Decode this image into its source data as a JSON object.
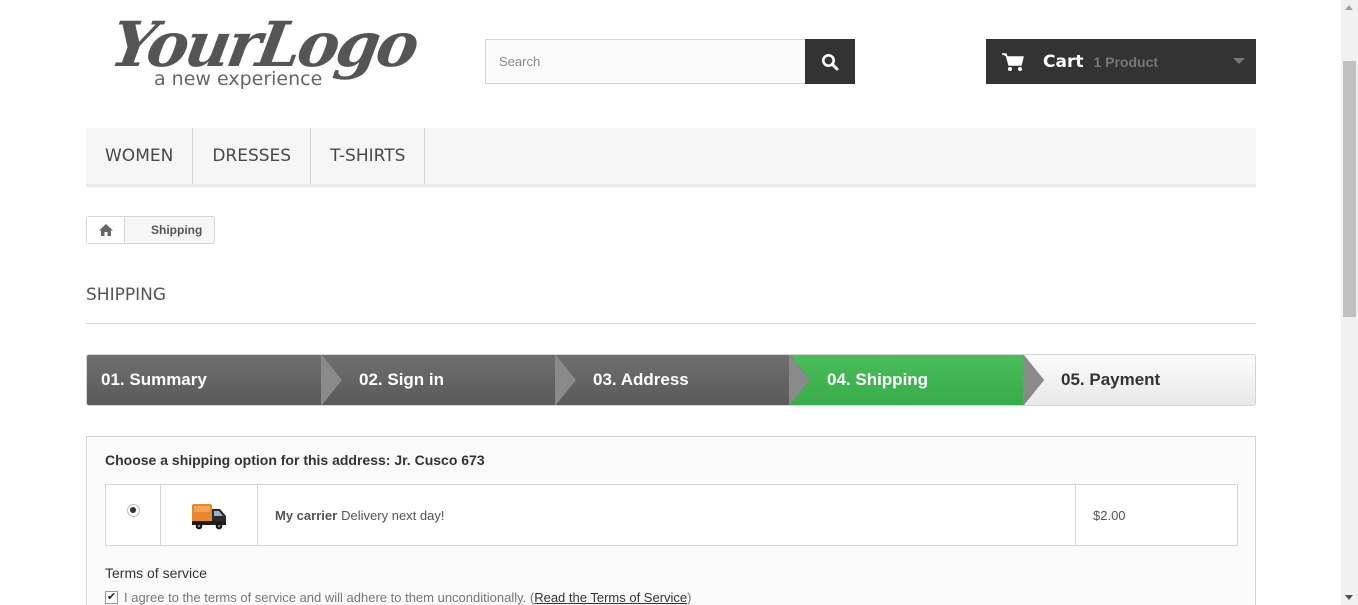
{
  "logo": {
    "script": "YourLogo",
    "tagline": "a new experience"
  },
  "search": {
    "placeholder": "Search",
    "icon": "search-icon"
  },
  "cart": {
    "label": "Cart",
    "quantity": "1 Product",
    "icon": "cart-icon"
  },
  "menu": {
    "items": [
      {
        "label": "WOMEN"
      },
      {
        "label": "DRESSES"
      },
      {
        "label": "T-SHIRTS"
      }
    ]
  },
  "breadcrumb": {
    "home_icon": "home-icon",
    "current": "Shipping"
  },
  "page": {
    "heading": "SHIPPING"
  },
  "steps": [
    {
      "label": "01. Summary",
      "state": "done"
    },
    {
      "label": "02. Sign in",
      "state": "done"
    },
    {
      "label": "03. Address",
      "state": "done"
    },
    {
      "label": "04. Shipping",
      "state": "current"
    },
    {
      "label": "05. Payment",
      "state": "todo"
    }
  ],
  "shipping": {
    "title": "Choose a shipping option for this address: Jr. Cusco 673",
    "carrier": {
      "name": "My carrier",
      "delay": "Delivery next day!",
      "price": "$2.00",
      "icon": "truck-icon",
      "selected": true
    }
  },
  "terms": {
    "heading": "Terms of service",
    "agree_text": "I agree to the terms of service and will adhere to them unconditionally. (",
    "link": "Read the Terms of Service",
    "close": ")",
    "checked": true
  },
  "colors": {
    "dark": "#333333",
    "step_done": "#5f5f5f",
    "step_current": "#3aae4b"
  }
}
